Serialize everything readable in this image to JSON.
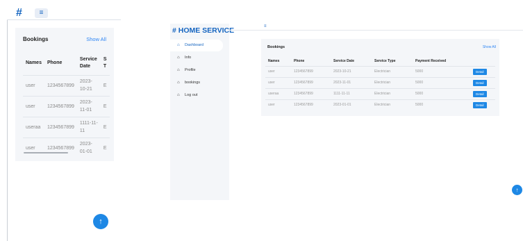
{
  "mobile": {
    "brand_hash": "#",
    "menu_icon": "hamburger-icon",
    "card": {
      "title": "Bookings",
      "show_all": "Show All",
      "headers": [
        "Names",
        "Phone",
        "Service Date",
        "S T"
      ],
      "rows": [
        [
          "user",
          "1234567899",
          "2023-10-21",
          "E"
        ],
        [
          "user",
          "1234567899",
          "2023-11-01",
          "E"
        ],
        [
          "useraa",
          "1234567899",
          "1111-11-11",
          "E"
        ],
        [
          "user",
          "1234567899",
          "2023-01-01",
          "E"
        ]
      ]
    },
    "fab_icon": "arrow-up-icon",
    "fab_glyph": "↑"
  },
  "desktop": {
    "brand": "# HOME SERVICE",
    "menu_glyph": "≡",
    "nav": [
      {
        "label": "Dashboard",
        "icon": "home-icon"
      },
      {
        "label": "Info",
        "icon": "home-icon"
      },
      {
        "label": "Profile",
        "icon": "home-icon"
      },
      {
        "label": "bookings",
        "icon": "home-icon"
      },
      {
        "label": "Log out",
        "icon": "home-icon"
      }
    ],
    "card": {
      "title": "Bookings",
      "show_all": "Show All",
      "headers": [
        "Names",
        "Phone",
        "Service Date",
        "Service Type",
        "Payment Received",
        ""
      ],
      "rows": [
        [
          "user",
          "1234567899",
          "2023-10-21",
          "Electrician",
          "5000",
          "Detail"
        ],
        [
          "user",
          "1234567899",
          "2023-11-01",
          "Electrician",
          "5000",
          "Detail"
        ],
        [
          "useraa",
          "1234567899",
          "1111-11-11",
          "Electrician",
          "5000",
          "Detail"
        ],
        [
          "user",
          "1234567899",
          "2023-01-01",
          "Electrician",
          "5000",
          "Detail"
        ]
      ]
    },
    "fab_glyph": "↑"
  },
  "colors": {
    "accent": "#1e88e5",
    "brand": "#1565c0",
    "card_bg": "#f4f6f9"
  }
}
